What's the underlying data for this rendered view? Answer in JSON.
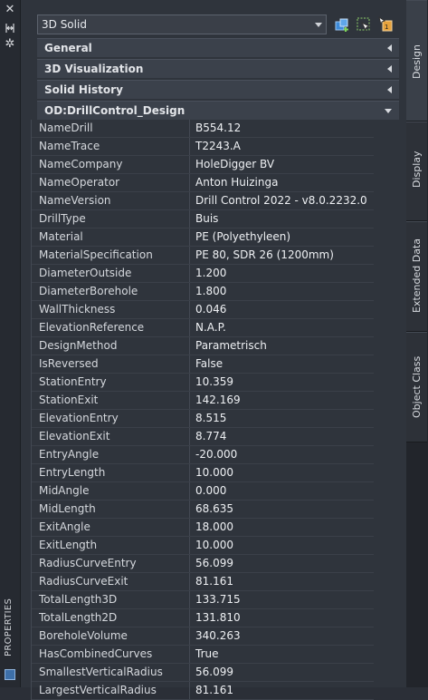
{
  "sidebar": {
    "close_icon": "close-icon",
    "pin_icon": "pin-icon",
    "settings_icon": "gear-icon",
    "vertical_label": "PROPERTIES"
  },
  "selector": {
    "value": "3D Solid",
    "buttons": [
      "quick-select-icon",
      "select-objects-icon",
      "toggle-pickadd-icon"
    ]
  },
  "sections": [
    {
      "title": "General",
      "expanded": false
    },
    {
      "title": "3D Visualization",
      "expanded": false
    },
    {
      "title": "Solid History",
      "expanded": false
    },
    {
      "title": "OD:DrillControl_Design",
      "expanded": true
    }
  ],
  "properties": [
    {
      "key": "NameDrill",
      "value": "B554.12"
    },
    {
      "key": "NameTrace",
      "value": "T2243.A"
    },
    {
      "key": "NameCompany",
      "value": "HoleDigger BV"
    },
    {
      "key": "NameOperator",
      "value": "Anton Huizinga"
    },
    {
      "key": "NameVersion",
      "value": "Drill Control 2022 - v8.0.2232.0"
    },
    {
      "key": "DrillType",
      "value": "Buis"
    },
    {
      "key": "Material",
      "value": "PE (Polyethyleen)"
    },
    {
      "key": "MaterialSpecification",
      "value": "PE 80, SDR 26 (1200mm)"
    },
    {
      "key": "DiameterOutside",
      "value": "1.200"
    },
    {
      "key": "DiameterBorehole",
      "value": "1.800"
    },
    {
      "key": "WallThickness",
      "value": "0.046"
    },
    {
      "key": "ElevationReference",
      "value": "N.A.P."
    },
    {
      "key": "DesignMethod",
      "value": "Parametrisch"
    },
    {
      "key": "IsReversed",
      "value": "False"
    },
    {
      "key": "StationEntry",
      "value": "10.359"
    },
    {
      "key": "StationExit",
      "value": "142.169"
    },
    {
      "key": "ElevationEntry",
      "value": "8.515"
    },
    {
      "key": "ElevationExit",
      "value": "8.774"
    },
    {
      "key": "EntryAngle",
      "value": "-20.000"
    },
    {
      "key": "EntryLength",
      "value": "10.000"
    },
    {
      "key": "MidAngle",
      "value": "0.000"
    },
    {
      "key": "MidLength",
      "value": "68.635"
    },
    {
      "key": "ExitAngle",
      "value": "18.000"
    },
    {
      "key": "ExitLength",
      "value": "10.000"
    },
    {
      "key": "RadiusCurveEntry",
      "value": "56.099"
    },
    {
      "key": "RadiusCurveExit",
      "value": "81.161"
    },
    {
      "key": "TotalLength3D",
      "value": "133.715"
    },
    {
      "key": "TotalLength2D",
      "value": "131.810"
    },
    {
      "key": "BoreholeVolume",
      "value": "340.263"
    },
    {
      "key": "HasCombinedCurves",
      "value": "True"
    },
    {
      "key": "SmallestVerticalRadius",
      "value": "56.099"
    },
    {
      "key": "LargestVerticalRadius",
      "value": "81.161"
    }
  ],
  "tabs": [
    {
      "label": "Design",
      "active": true
    },
    {
      "label": "Display",
      "active": false
    },
    {
      "label": "Extended Data",
      "active": false
    },
    {
      "label": "Object Class",
      "active": false
    }
  ]
}
